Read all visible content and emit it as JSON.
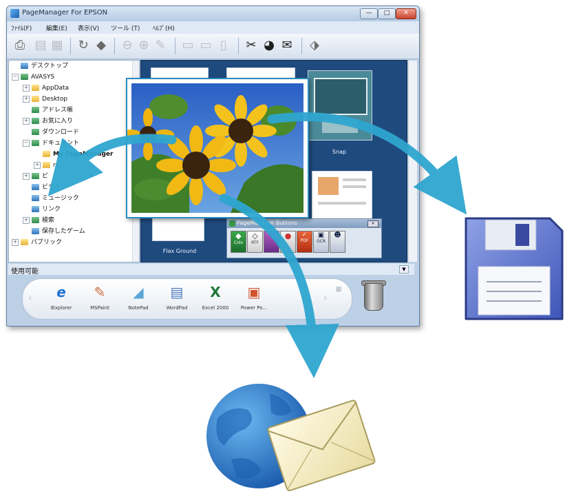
{
  "window": {
    "title": "PageManager For EPSON",
    "controls": [
      "—",
      "□",
      "✕"
    ]
  },
  "menu": [
    "ﾌｧｲﾙ(F)",
    "編集(E)",
    "表示(V)",
    "ツール (T)",
    "ﾍﾙﾌﾟ(H)"
  ],
  "tree": {
    "items": [
      {
        "label": "デスクトップ",
        "indent": 0,
        "expander": "",
        "folder": "b"
      },
      {
        "label": "AVASYS",
        "indent": 0,
        "expander": "⊟",
        "folder": "g"
      },
      {
        "label": "AppData",
        "indent": 1,
        "expander": "⊞",
        "folder": "y"
      },
      {
        "label": "Desktop",
        "indent": 1,
        "expander": "⊞",
        "folder": "y"
      },
      {
        "label": "アドレス帳",
        "indent": 1,
        "expander": "",
        "folder": "g"
      },
      {
        "label": "お気に入り",
        "indent": 1,
        "expander": "⊞",
        "folder": "g"
      },
      {
        "label": "ダウンロード",
        "indent": 1,
        "expander": "",
        "folder": "g"
      },
      {
        "label": "ドキュメント",
        "indent": 1,
        "expander": "⊟",
        "folder": "g"
      },
      {
        "label": "My PageManager",
        "indent": 2,
        "expander": "",
        "folder": "y",
        "bold": true
      },
      {
        "label": "rs",
        "indent": 2,
        "expander": "⊞",
        "folder": "y"
      },
      {
        "label": "ピ",
        "indent": 1,
        "expander": "⊞",
        "folder": "g"
      },
      {
        "label": "ビデオ",
        "indent": 1,
        "expander": "",
        "folder": "b"
      },
      {
        "label": "ミュージック",
        "indent": 1,
        "expander": "",
        "folder": "b"
      },
      {
        "label": "リンク",
        "indent": 1,
        "expander": "",
        "folder": "b"
      },
      {
        "label": "検索",
        "indent": 1,
        "expander": "⊞",
        "folder": "g"
      },
      {
        "label": "保存したゲーム",
        "indent": 1,
        "expander": "",
        "folder": "b"
      },
      {
        "label": "パブリック",
        "indent": 0,
        "expander": "⊞",
        "folder": "y"
      }
    ]
  },
  "thumbnails": {
    "captions": [
      "Snap",
      "Flax Ground"
    ]
  },
  "popup": {
    "title": "PageManager Buttons",
    "buttons": [
      "Colo",
      "RTF",
      "",
      "",
      "PDF",
      "OCR",
      ""
    ]
  },
  "available_label": "使用可能",
  "apps": [
    "IExplorer",
    "MSPaint",
    "NotePad",
    "WordPad",
    "Excel 2000",
    "Power Po..."
  ],
  "colors": {
    "arrow": "#2fa6d0",
    "pane_bg": "#1f4a7e",
    "window_chrome": "#bcd0e6"
  }
}
